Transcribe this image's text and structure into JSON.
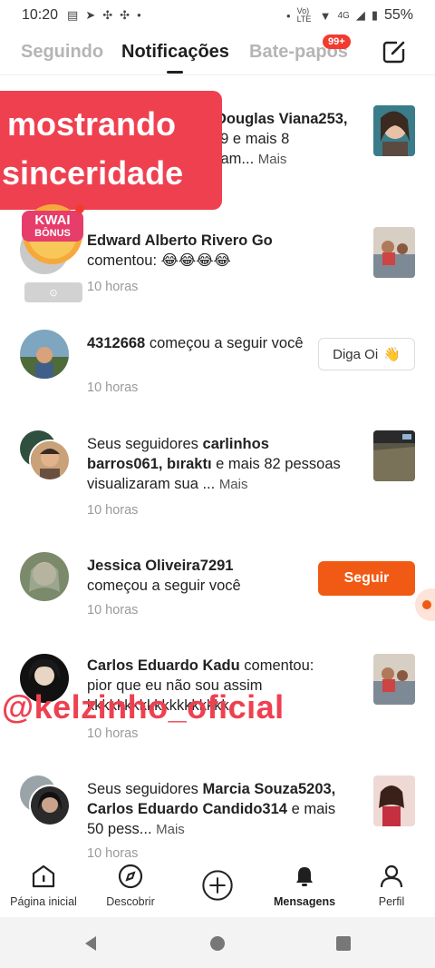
{
  "status_bar": {
    "time": "10:20",
    "network": "Vo) LTE",
    "signal": "4G",
    "battery": "55%"
  },
  "tabs": [
    {
      "label": "Seguindo",
      "active": false
    },
    {
      "label": "Notificações",
      "active": true
    },
    {
      "label": "Bate-papos",
      "active": false
    }
  ],
  "badge": "99+",
  "compose_icon": "edit-icon",
  "overlay": {
    "line1": "mostrando",
    "line2": "sinceridade",
    "kwai_line1": "KWAI",
    "kwai_line2": "BÔNUS",
    "watermark": "@kelzinho_oficial"
  },
  "notifications": [
    {
      "name": "Douglas Viana253,",
      "text_a": "79 e mais 8",
      "text_b": "ram...",
      "more": "Mais"
    },
    {
      "name": "Edward Alberto Rivero Go",
      "text": "comentou: 😂😂😂😂",
      "time": "10 horas"
    },
    {
      "name": "4312668",
      "text": "começou a seguir você",
      "time": "10 horas",
      "button": "Diga Oi",
      "button_emoji": "👋"
    },
    {
      "prefix": "Seus seguidores",
      "names": "carlinhos barros061, bıraktı",
      "text": "e mais 82 pessoas visualizaram sua ...",
      "more": "Mais",
      "time": "10 horas"
    },
    {
      "name": "Jessica Oliveira7291",
      "text": "começou a seguir você",
      "time": "10 horas",
      "button": "Seguir"
    },
    {
      "name": "Carlos Eduardo Kadu",
      "text": "comentou: pior que eu não sou assim kkkkkkkkkkkkkkkkkkk",
      "time": "10 horas"
    },
    {
      "prefix": "Seus seguidores",
      "names": "Marcia Souza5203, Carlos Eduardo Candido314",
      "text": "e mais 50 pess...",
      "more": "Mais",
      "time": "10 horas"
    }
  ],
  "bottom_nav": [
    {
      "label": "Página inicial",
      "icon": "home-icon",
      "active": false
    },
    {
      "label": "Descobrir",
      "icon": "compass-icon",
      "active": false
    },
    {
      "label": "",
      "icon": "plus-circle-icon",
      "active": false
    },
    {
      "label": "Mensagens",
      "icon": "bell-icon",
      "active": true
    },
    {
      "label": "Perfil",
      "icon": "person-icon",
      "active": false
    }
  ],
  "colors": {
    "accent": "#f05a14",
    "overlay_red": "#ef4050",
    "badge_red": "#f23b2f"
  }
}
